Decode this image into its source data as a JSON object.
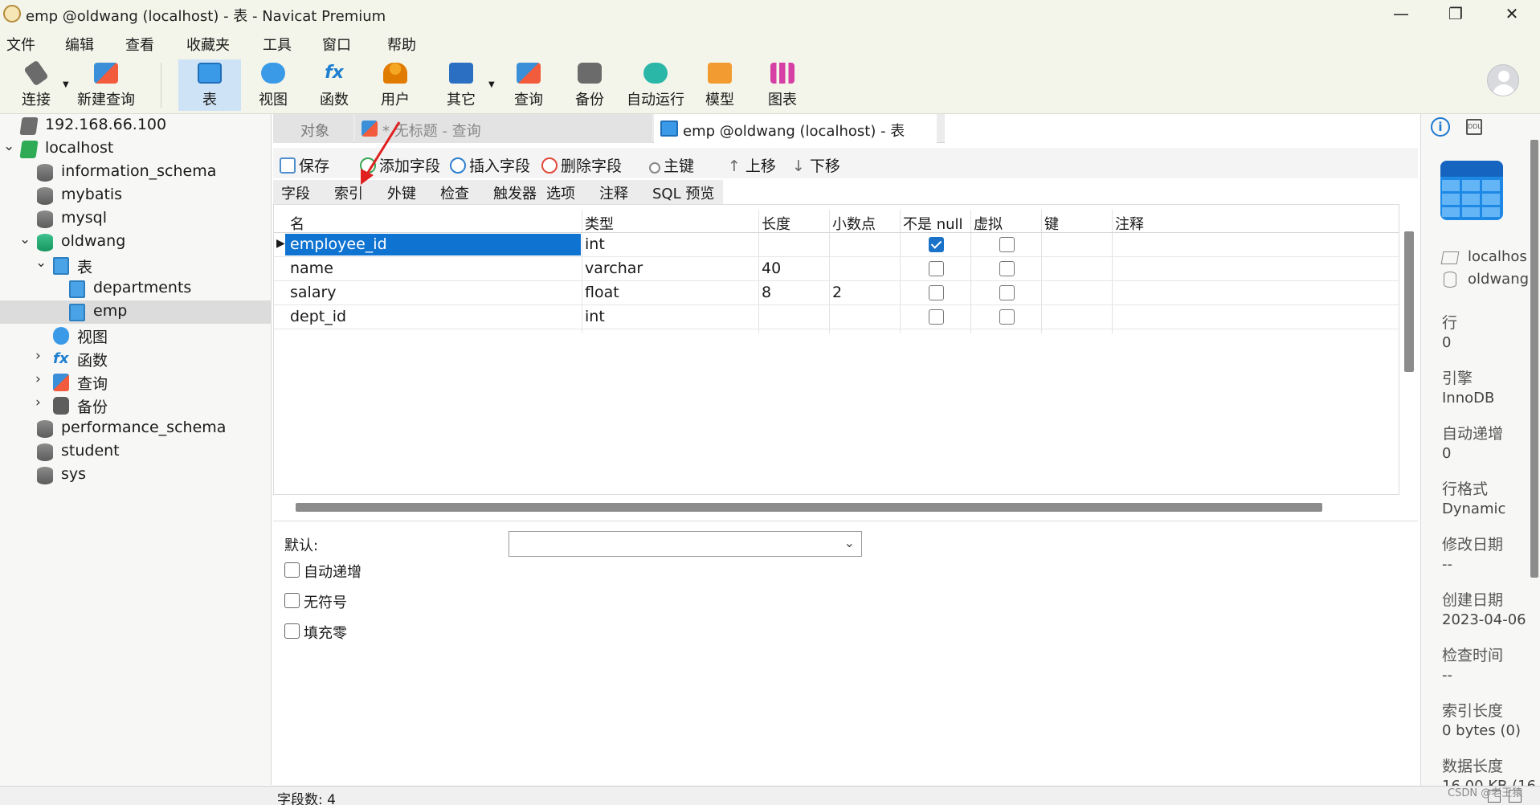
{
  "window": {
    "title": "emp @oldwang (localhost) - 表 - Navicat Premium",
    "minimize": "—",
    "maximize": "❐",
    "close": "✕"
  },
  "menu": [
    "文件",
    "编辑",
    "查看",
    "收藏夹",
    "工具",
    "窗口",
    "帮助"
  ],
  "toolbar": [
    {
      "label": "连接",
      "icon": "plug-icon"
    },
    {
      "label": "新建查询",
      "icon": "new-query-icon"
    },
    {
      "label": "表",
      "icon": "table-icon",
      "active": true
    },
    {
      "label": "视图",
      "icon": "view-icon"
    },
    {
      "label": "函数",
      "icon": "function-icon"
    },
    {
      "label": "用户",
      "icon": "user-icon"
    },
    {
      "label": "其它",
      "icon": "other-icon"
    },
    {
      "label": "查询",
      "icon": "query-icon"
    },
    {
      "label": "备份",
      "icon": "backup-icon"
    },
    {
      "label": "自动运行",
      "icon": "robot-icon"
    },
    {
      "label": "模型",
      "icon": "model-icon"
    },
    {
      "label": "图表",
      "icon": "chart-icon"
    }
  ],
  "tree": [
    {
      "label": "192.168.66.100"
    },
    {
      "label": "localhost"
    },
    {
      "label": "information_schema"
    },
    {
      "label": "mybatis"
    },
    {
      "label": "mysql"
    },
    {
      "label": "oldwang"
    },
    {
      "label": "表"
    },
    {
      "label": "departments"
    },
    {
      "label": "emp"
    },
    {
      "label": "视图"
    },
    {
      "label": "函数"
    },
    {
      "label": "查询"
    },
    {
      "label": "备份"
    },
    {
      "label": "performance_schema"
    },
    {
      "label": "student"
    },
    {
      "label": "sys"
    }
  ],
  "tabs": {
    "objects": "对象",
    "query_tab": "* 无标题 - 查询",
    "table_tab": "emp @oldwang (localhost) - 表"
  },
  "field_toolbar": {
    "save": "保存",
    "add_field": "添加字段",
    "insert_field": "插入字段",
    "delete_field": "删除字段",
    "primary_key": "主键",
    "move_up": "上移",
    "move_down": "下移"
  },
  "subtabs": [
    "字段",
    "索引",
    "外键",
    "检查",
    "触发器",
    "选项",
    "注释",
    "SQL 预览"
  ],
  "grid": {
    "headers": [
      "名",
      "类型",
      "长度",
      "小数点",
      "不是 null",
      "虚拟",
      "键",
      "注释"
    ],
    "rows": [
      {
        "name": "employee_id",
        "type": "int",
        "length": "",
        "decimals": "",
        "not_null": true,
        "virtual": false,
        "selected": true
      },
      {
        "name": "name",
        "type": "varchar",
        "length": "40",
        "decimals": "",
        "not_null": false,
        "virtual": false
      },
      {
        "name": "salary",
        "type": "float",
        "length": "8",
        "decimals": "2",
        "not_null": false,
        "virtual": false
      },
      {
        "name": "dept_id",
        "type": "int",
        "length": "",
        "decimals": "",
        "not_null": false,
        "virtual": false
      }
    ]
  },
  "props": {
    "default_label": "默认:",
    "default_value": "",
    "auto_increment": "自动递增",
    "unsigned": "无符号",
    "zerofill": "填充零"
  },
  "status": {
    "field_count": "字段数: 4"
  },
  "info": {
    "host": "localhos",
    "database": "oldwang",
    "rows_label": "行",
    "rows_value": "0",
    "engine_label": "引擎",
    "engine_value": "InnoDB",
    "auto_inc_label": "自动递增",
    "auto_inc_value": "0",
    "row_format_label": "行格式",
    "row_format_value": "Dynamic",
    "modified_label": "修改日期",
    "modified_value": "--",
    "created_label": "创建日期",
    "created_value": "2023-04-06",
    "check_time_label": "检查时间",
    "check_time_value": "--",
    "index_len_label": "索引长度",
    "index_len_value": "0 bytes (0)",
    "data_len_label": "数据长度",
    "data_len_value": "16.00 KB (16"
  },
  "watermark": "CSDN @老王猿",
  "colors": {
    "selection": "#0f73d2",
    "annotation_arrow": "#e02020",
    "toolbar_bg": "#f4f5ea"
  }
}
